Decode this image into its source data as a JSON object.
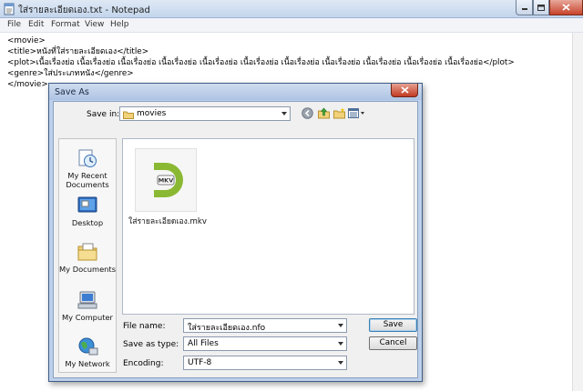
{
  "notepad": {
    "title": "ใส่รายละเอียดเอง.txt - Notepad",
    "menu": [
      "File",
      "Edit",
      "Format",
      "View",
      "Help"
    ],
    "lines": [
      "<movie>",
      "<title>หนังที่ใส่รายละเอียดเอง</title>",
      "<plot>เนื้อเรื่องย่อ เนื้อเรื่องย่อ เนื้อเรื่องย่อ เนื้อเรื่องย่อ เนื้อเรื่องย่อ เนื้อเรื่องย่อ เนื้อเรื่องย่อ เนื้อเรื่องย่อ เนื้อเรื่องย่อ เนื้อเรื่องย่อ เนื้อเรื่องย่อ</plot>",
      "<genre>ใส่ประเภทหนัง</genre>",
      "</movie>"
    ]
  },
  "dialog": {
    "title": "Save As",
    "save_in_label": "Save in:",
    "save_in_value": "movies",
    "places": [
      "My Recent Documents",
      "Desktop",
      "My Documents",
      "My Computer",
      "My Network"
    ],
    "files": [
      {
        "name": "ใส่รายละเอียดเอง.mkv",
        "badge": "MKV",
        "letter": "D"
      }
    ],
    "file_name_label": "File name:",
    "file_name_value": "ใส่รายละเอียดเอง.nfo",
    "save_as_type_label": "Save as type:",
    "save_as_type_value": "All Files",
    "encoding_label": "Encoding:",
    "encoding_value": "UTF-8",
    "save_button": "Save",
    "cancel_button": "Cancel"
  },
  "colors": {
    "title_bar": "#c3d5ec",
    "dialog_frame": "#bcd0ea",
    "close_red": "#c7432a",
    "mkv_green": "#8ab833"
  }
}
